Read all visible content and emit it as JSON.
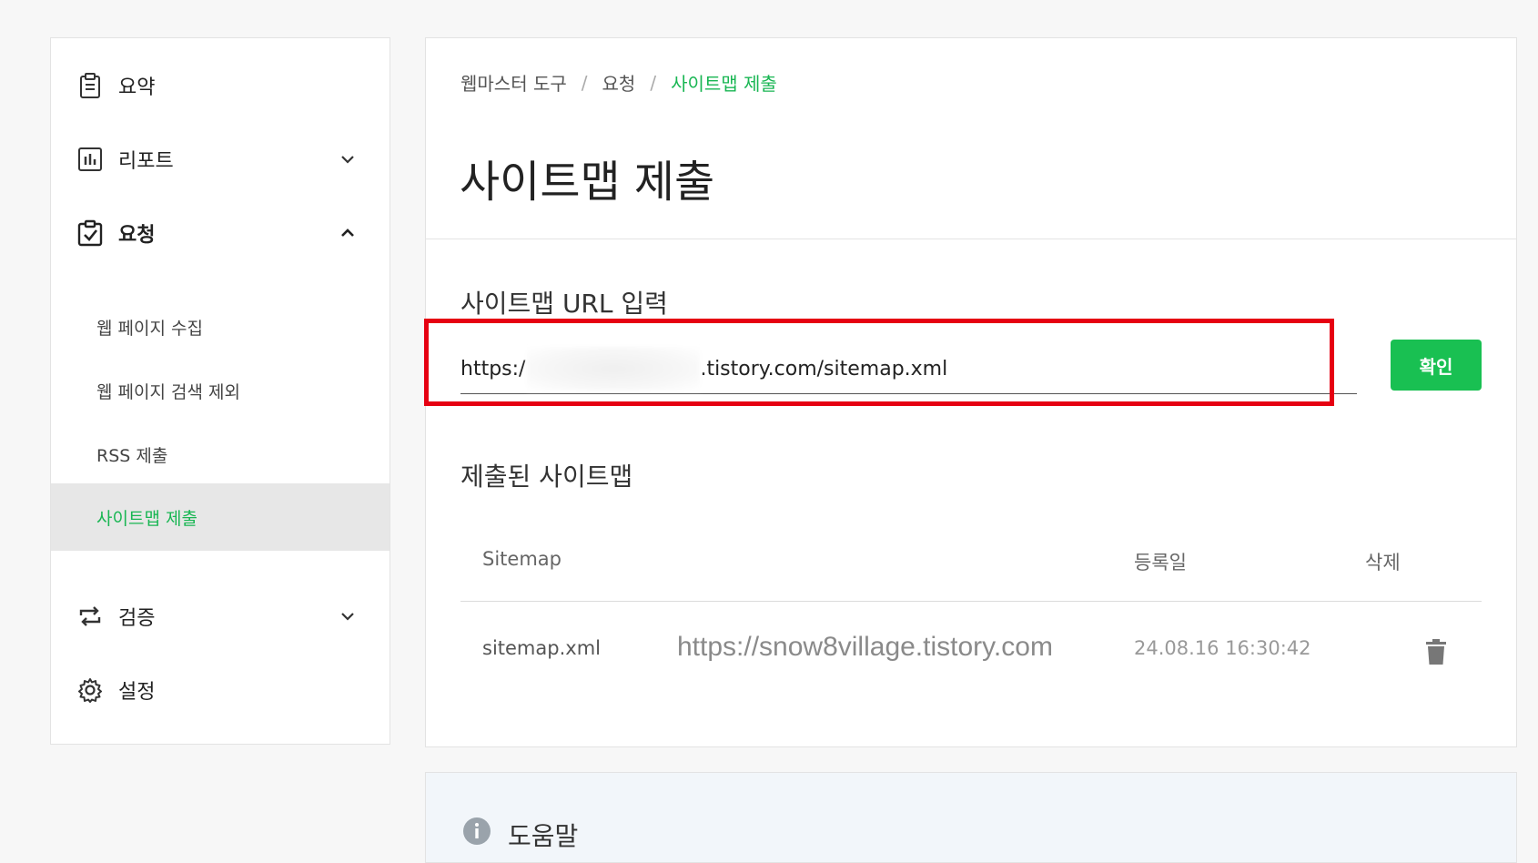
{
  "sidebar": {
    "items": [
      {
        "label": "요약",
        "icon": "clipboard-icon"
      },
      {
        "label": "리포트",
        "icon": "bar-chart-icon"
      },
      {
        "label": "요청",
        "icon": "checkbox-clipboard-icon"
      },
      {
        "label": "검증",
        "icon": "repeat-icon"
      },
      {
        "label": "설정",
        "icon": "gear-icon"
      }
    ],
    "sub_items": [
      {
        "label": "웹 페이지 수집"
      },
      {
        "label": "웹 페이지 검색 제외"
      },
      {
        "label": "RSS 제출"
      },
      {
        "label": "사이트맵 제출"
      }
    ]
  },
  "breadcrumb": {
    "items": [
      "웹마스터 도구",
      "요청",
      "사이트맵 제출"
    ],
    "separator": "/"
  },
  "page": {
    "title": "사이트맵 제출"
  },
  "url_input": {
    "label": "사이트맵 URL 입력",
    "value_prefix": "https:/",
    "value_suffix": ".tistory.com/sitemap.xml",
    "button_label": "확인"
  },
  "submitted": {
    "title": "제출된 사이트맵",
    "columns": [
      "Sitemap",
      "등록일",
      "삭제"
    ],
    "rows": [
      {
        "sitemap": "sitemap.xml",
        "date": "24.08.16 16:30:42"
      }
    ]
  },
  "watermark": "https://snow8village.tistory.com",
  "help": {
    "label": "도움말"
  },
  "colors": {
    "accent": "#19b653",
    "button": "#19c052",
    "highlight": "#e60012"
  }
}
